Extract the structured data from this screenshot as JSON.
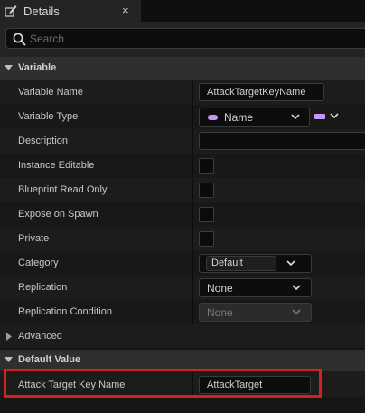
{
  "tab": {
    "title": "Details",
    "icon": "details-pencil-icon",
    "close": "×"
  },
  "search": {
    "placeholder": "Search",
    "icon": "search-icon"
  },
  "colors": {
    "name_type_pill": "#c994f2",
    "highlight": "#d62020"
  },
  "variable_section": {
    "label": "Variable",
    "rows": {
      "variable_name": {
        "label": "Variable Name",
        "value": "AttackTargetKeyName"
      },
      "variable_type": {
        "label": "Variable Type",
        "value": "Name"
      },
      "description": {
        "label": "Description",
        "value": ""
      },
      "instance_editable": {
        "label": "Instance Editable",
        "checked": false
      },
      "blueprint_read_only": {
        "label": "Blueprint Read Only",
        "checked": false
      },
      "expose_on_spawn": {
        "label": "Expose on Spawn",
        "checked": false
      },
      "private": {
        "label": "Private",
        "checked": false
      },
      "category": {
        "label": "Category",
        "value": "Default"
      },
      "replication": {
        "label": "Replication",
        "value": "None"
      },
      "replication_condition": {
        "label": "Replication Condition",
        "value": "None"
      }
    }
  },
  "advanced": {
    "label": "Advanced"
  },
  "default_value_section": {
    "label": "Default Value",
    "rows": {
      "attack_target_key_name": {
        "label": "Attack Target Key Name",
        "value": "AttackTarget"
      }
    }
  }
}
